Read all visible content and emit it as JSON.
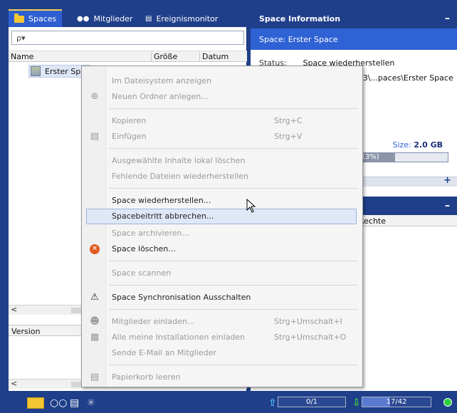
{
  "tabs": [
    {
      "label": "Spaces",
      "icon": "folder-icon"
    },
    {
      "label": "Mitglieder",
      "icon": "members-icon"
    },
    {
      "label": "Ereignismonitor",
      "icon": "monitor-icon"
    }
  ],
  "search": {
    "placeholder": "ρ▾"
  },
  "file_columns": [
    "Name",
    "Größe",
    "Datum"
  ],
  "space_row": {
    "label": "Erster Spa"
  },
  "version_column": "Version",
  "right_panel": {
    "title": "Space Information",
    "subtitle": "Space:  Erster Space",
    "status_label": "Status:",
    "status_value": "Space wiederherstellen",
    "path": "s3\\...paces\\Erster Space",
    "size_label": "Size:",
    "size_value": "2.0 GB",
    "usage_text": "(3%)",
    "usage_percent": 3,
    "permissions_column": "Rechte"
  },
  "context_menu": {
    "items": [
      {
        "label": "Im Dateisystem anzeigen",
        "disabled": true,
        "icon": ""
      },
      {
        "label": "Neuen Ordner anlegen...",
        "disabled": true,
        "icon": "new-folder-icon"
      },
      {
        "label": "Kopieren",
        "shortcut": "Strg+C",
        "disabled": true,
        "icon": ""
      },
      {
        "label": "Einfügen",
        "shortcut": "Strg+V",
        "disabled": true,
        "icon": "paste-icon"
      },
      {
        "label": "Ausgewählte Inhalte lokal löschen",
        "disabled": true,
        "icon": ""
      },
      {
        "label": "Fehlende Dateien wiederherstellen",
        "disabled": true,
        "icon": ""
      },
      {
        "label": "Space wiederherstellen...",
        "disabled": false,
        "icon": ""
      },
      {
        "label": "Spacebeitritt abbrechen...",
        "disabled": false,
        "icon": "",
        "highlighted": true
      },
      {
        "label": "Space archivieren...",
        "disabled": true,
        "icon": ""
      },
      {
        "label": "Space löschen...",
        "disabled": false,
        "icon": "delete-icon"
      },
      {
        "label": "Space scannen",
        "disabled": true,
        "icon": ""
      },
      {
        "label": "Space Synchronisation Ausschalten",
        "disabled": false,
        "icon": "warning-icon"
      },
      {
        "label": "Mitglieder einladen...",
        "shortcut": "Strg+Umschalt+I",
        "disabled": true,
        "icon": "invite-icon"
      },
      {
        "label": "Alle meine Installationen einladen",
        "shortcut": "Strg+Umschalt+O",
        "disabled": true,
        "icon": "installations-icon"
      },
      {
        "label": "Sende E-Mail an Mitglieder",
        "disabled": true,
        "icon": ""
      },
      {
        "label": "Papierkorb leeren",
        "disabled": true,
        "icon": "trash-icon"
      }
    ]
  },
  "statusbar": {
    "upload_text": "0/1",
    "upload_fraction": 0,
    "download_text": "17/42",
    "download_fraction": 0.405
  },
  "colors": {
    "header": "#1f3f8a",
    "accent": "#2f62d4",
    "menu_highlight": "#dfe8f6"
  }
}
